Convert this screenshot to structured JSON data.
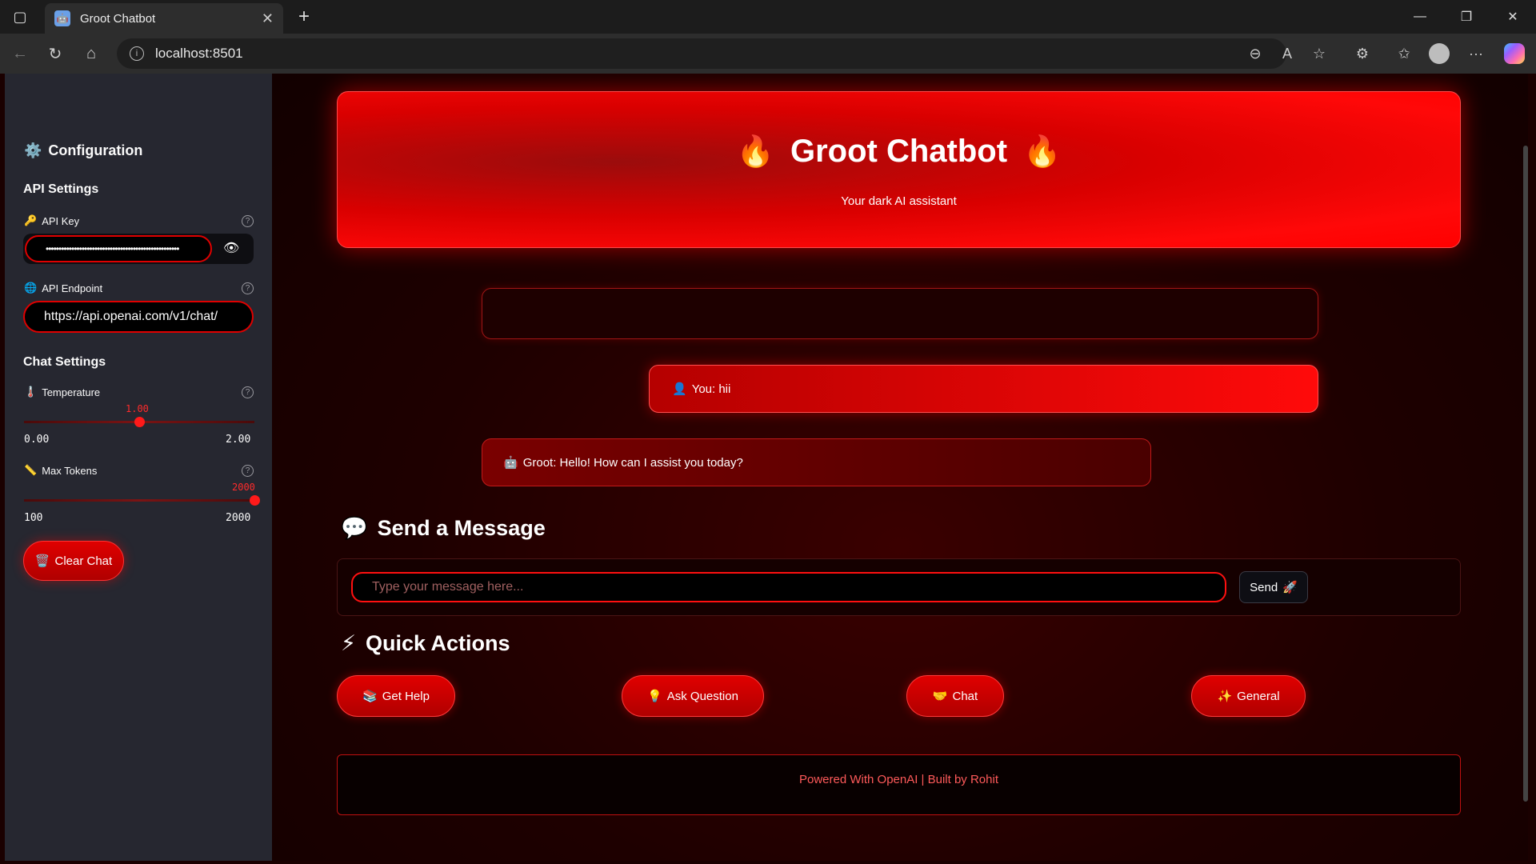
{
  "browser": {
    "tab_title": "Groot Chatbot",
    "url": "localhost:8501"
  },
  "sidebar": {
    "title": "Configuration",
    "api_settings_heading": "API Settings",
    "api_key_label": "API Key",
    "api_key_value": "••••••••••••••••••••••••••••••••••••••••••••••••••••",
    "api_endpoint_label": "API Endpoint",
    "api_endpoint_value": "https://api.openai.com/v1/chat/",
    "chat_settings_heading": "Chat Settings",
    "temperature": {
      "label": "Temperature",
      "value": "1.00",
      "min": "0.00",
      "max": "2.00",
      "fraction": 0.5
    },
    "max_tokens": {
      "label": "Max Tokens",
      "value": "2000",
      "min": "100",
      "max": "2000",
      "fraction": 1.0
    },
    "clear_button": "Clear Chat"
  },
  "main": {
    "title": "Groot Chatbot",
    "subtitle": "Your dark AI assistant",
    "messages": [
      {
        "role": "user",
        "text": "You: hii"
      },
      {
        "role": "bot",
        "text": "Groot: Hello! How can I assist you today?"
      }
    ],
    "send_heading": "Send a Message",
    "input_placeholder": "Type your message here...",
    "send_button": "Send",
    "quick_actions_heading": "Quick Actions",
    "quick_actions": [
      "Get Help",
      "Ask Question",
      "Chat",
      "General"
    ],
    "footer": "Powered With OpenAI | Built by Rohit"
  },
  "colors": {
    "accent": "#ff0000",
    "sidebar_bg": "#262730",
    "main_bg": "#1e0000"
  }
}
